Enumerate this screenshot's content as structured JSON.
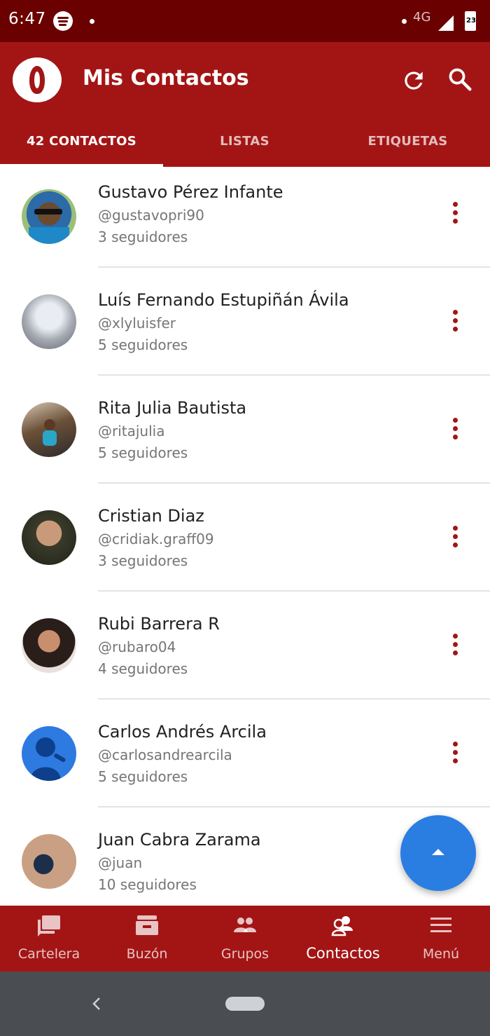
{
  "status_bar": {
    "time": "6:47",
    "network": "4G",
    "battery": "23"
  },
  "app_bar": {
    "title": "Mis Contactos",
    "tabs": [
      {
        "label": "42 CONTACTOS",
        "active": true
      },
      {
        "label": "LISTAS",
        "active": false
      },
      {
        "label": "ETIQUETAS",
        "active": false
      }
    ]
  },
  "contacts": [
    {
      "name": "Gustavo Pérez Infante",
      "handle": "@gustavopri90",
      "followers": "3 seguidores"
    },
    {
      "name": "Luís Fernando Estupiñán Ávila",
      "handle": "@xlyluisfer",
      "followers": "5 seguidores"
    },
    {
      "name": "Rita Julia Bautista",
      "handle": "@ritajulia",
      "followers": "5 seguidores"
    },
    {
      "name": "Cristian Diaz",
      "handle": "@cridiak.graff09",
      "followers": "3 seguidores"
    },
    {
      "name": "Rubi Barrera R",
      "handle": "@rubaro04",
      "followers": "4 seguidores"
    },
    {
      "name": "Carlos Andrés Arcila",
      "handle": "@carlosandrearcila",
      "followers": "5 seguidores"
    },
    {
      "name": "Juan Cabra Zarama",
      "handle": "@juan",
      "followers": "10 seguidores"
    }
  ],
  "bottom_nav": [
    {
      "label": "Cartelera",
      "icon": "message-board-icon",
      "active": false
    },
    {
      "label": "Buzón",
      "icon": "inbox-icon",
      "active": false
    },
    {
      "label": "Grupos",
      "icon": "groups-icon",
      "active": false
    },
    {
      "label": "Contactos",
      "icon": "contacts-icon",
      "active": true
    },
    {
      "label": "Menú",
      "icon": "menu-icon",
      "active": false
    }
  ],
  "colors": {
    "primary": "#a31515",
    "status_bar": "#6b0000",
    "fab": "#2a7de1",
    "system_nav": "#4a4d51"
  }
}
